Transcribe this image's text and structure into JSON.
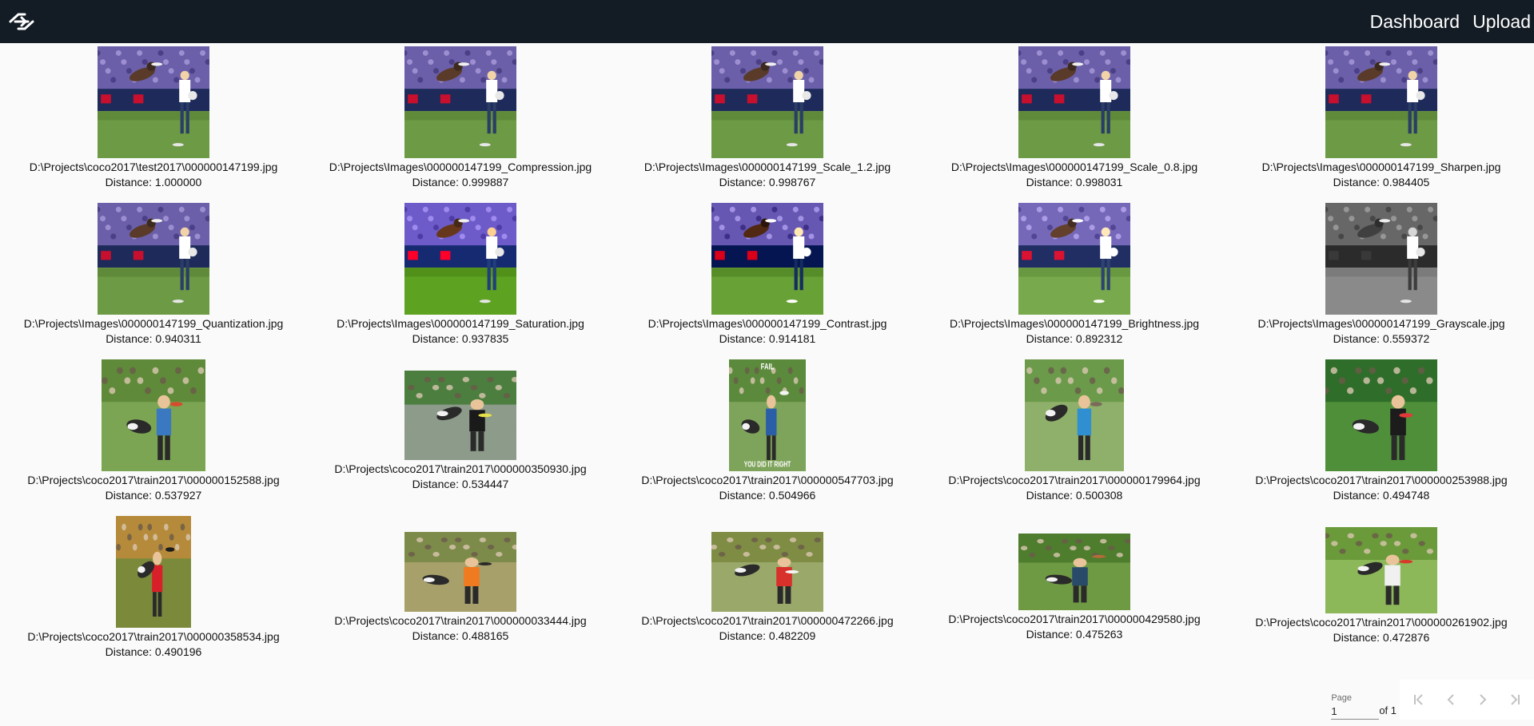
{
  "nav": {
    "dashboard_label": "Dashboard",
    "upload_label": "Upload"
  },
  "results": [
    {
      "path": "D:\\Projects\\coco2017\\test2017\\000000147199.jpg",
      "distance": "Distance: 1.000000",
      "filter": "none"
    },
    {
      "path": "D:\\Projects\\Images\\000000147199_Compression.jpg",
      "distance": "Distance: 0.999887",
      "filter": "none"
    },
    {
      "path": "D:\\Projects\\Images\\000000147199_Scale_1.2.jpg",
      "distance": "Distance: 0.998767",
      "filter": "none"
    },
    {
      "path": "D:\\Projects\\Images\\000000147199_Scale_0.8.jpg",
      "distance": "Distance: 0.998031",
      "filter": "none"
    },
    {
      "path": "D:\\Projects\\Images\\000000147199_Sharpen.jpg",
      "distance": "Distance: 0.984405",
      "filter": "none"
    },
    {
      "path": "D:\\Projects\\Images\\000000147199_Quantization.jpg",
      "distance": "Distance: 0.940311",
      "filter": "none"
    },
    {
      "path": "D:\\Projects\\Images\\000000147199_Saturation.jpg",
      "distance": "Distance: 0.937835",
      "filter": "saturate"
    },
    {
      "path": "D:\\Projects\\Images\\000000147199_Contrast.jpg",
      "distance": "Distance: 0.914181",
      "filter": "contrast"
    },
    {
      "path": "D:\\Projects\\Images\\000000147199_Brightness.jpg",
      "distance": "Distance: 0.892312",
      "filter": "bright"
    },
    {
      "path": "D:\\Projects\\Images\\000000147199_Grayscale.jpg",
      "distance": "Distance: 0.559372",
      "filter": "gray"
    },
    {
      "path": "D:\\Projects\\coco2017\\train2017\\000000152588.jpg",
      "distance": "Distance: 0.537927",
      "filter": "none"
    },
    {
      "path": "D:\\Projects\\coco2017\\train2017\\000000350930.jpg",
      "distance": "Distance: 0.534447",
      "filter": "none"
    },
    {
      "path": "D:\\Projects\\coco2017\\train2017\\000000547703.jpg",
      "distance": "Distance: 0.504966",
      "filter": "none"
    },
    {
      "path": "D:\\Projects\\coco2017\\train2017\\000000179964.jpg",
      "distance": "Distance: 0.500308",
      "filter": "none"
    },
    {
      "path": "D:\\Projects\\coco2017\\train2017\\000000253988.jpg",
      "distance": "Distance: 0.494748",
      "filter": "none"
    },
    {
      "path": "D:\\Projects\\coco2017\\train2017\\000000358534.jpg",
      "distance": "Distance: 0.490196",
      "filter": "none"
    },
    {
      "path": "D:\\Projects\\coco2017\\train2017\\000000033444.jpg",
      "distance": "Distance: 0.488165",
      "filter": "none"
    },
    {
      "path": "D:\\Projects\\coco2017\\train2017\\000000472266.jpg",
      "distance": "Distance: 0.482209",
      "filter": "none"
    },
    {
      "path": "D:\\Projects\\coco2017\\train2017\\000000429580.jpg",
      "distance": "Distance: 0.475263",
      "filter": "none"
    },
    {
      "path": "D:\\Projects\\coco2017\\train2017\\000000261902.jpg",
      "distance": "Distance: 0.472876",
      "filter": "none"
    }
  ],
  "overlay_texts": {
    "meme_top": "FAIL",
    "meme_bottom": "YOU DID IT RIGHT",
    "banner_brand": "PURINA"
  },
  "paginator": {
    "page_label": "Page",
    "page_value": "1",
    "of_total": "of 1"
  },
  "colors": {
    "topbar": "#131b24",
    "background": "#fafafa",
    "text": "#111111",
    "grass": "#5f8a3a",
    "banner": "#1d2a5a"
  }
}
